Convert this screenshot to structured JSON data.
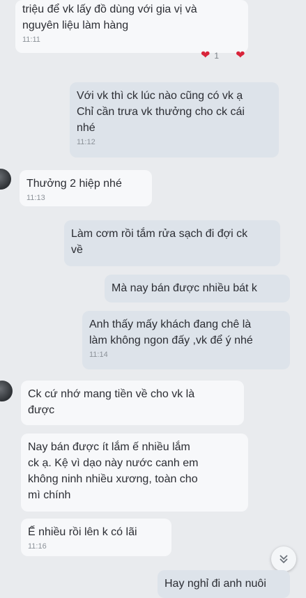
{
  "messages": [
    {
      "id": "m1",
      "text": "triệu để vk lấy  đồ dùng với gia vị và\nnguyên liệu làm hàng",
      "time": "11:11"
    },
    {
      "id": "m2",
      "text": "Với vk thì ck lúc nào cũng có vk ạ\nChỉ cần trưa vk thưởng cho ck cái\nnhé",
      "time": "11:12"
    },
    {
      "id": "m3",
      "text": "Thưởng 2 hiệp nhé",
      "time": "11:13"
    },
    {
      "id": "m4",
      "text": "Làm cơm rồi tắm rửa sạch đi đợi ck\nvề"
    },
    {
      "id": "m5",
      "text": "Mà nay bán được nhiều bát k"
    },
    {
      "id": "m6",
      "text": "Anh thấy mấy khách đang chê là\nlàm không ngon đấy ,vk để ý nhé",
      "time": "11:14"
    },
    {
      "id": "m7",
      "text": "Ck cứ nhớ mang tiền về cho vk là\nđược"
    },
    {
      "id": "m8",
      "text": "Nay bán được ít lắm ế nhiều lắm\nck ạ. Kệ vì dạo này nước canh em\nkhông ninh nhiều xương, toàn cho\nmì chính"
    },
    {
      "id": "m9",
      "text": "Ế nhiều rồi lên k có lãi",
      "time": "11:16"
    },
    {
      "id": "m10",
      "text": "Hay nghỉ đi anh nuôi"
    }
  ],
  "reactions": {
    "count": "1",
    "icon": "heart",
    "color": "#d8243a"
  },
  "scroll_button": {
    "icon": "double-chevron-down"
  }
}
